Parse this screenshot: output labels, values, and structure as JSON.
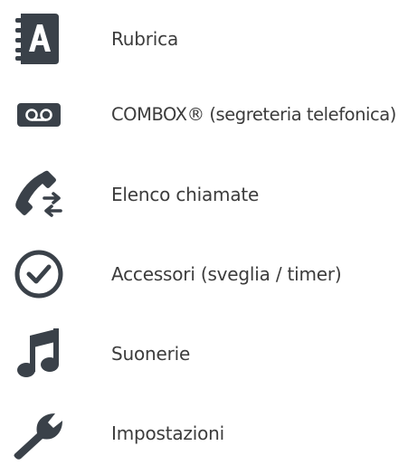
{
  "menu": {
    "icon_color": "#3a4149",
    "items": [
      {
        "label": "Rubrica",
        "icon": "address-book-icon"
      },
      {
        "label": "COMBOX® (segreteria telefonica)",
        "icon": "voicemail-icon"
      },
      {
        "label": "Elenco chiamate",
        "icon": "call-log-icon"
      },
      {
        "label": "Accessori (sveglia / timer)",
        "icon": "alarm-clock-icon"
      },
      {
        "label": "Suonerie",
        "icon": "music-note-icon"
      },
      {
        "label": "Impostazioni",
        "icon": "wrench-icon"
      }
    ]
  }
}
